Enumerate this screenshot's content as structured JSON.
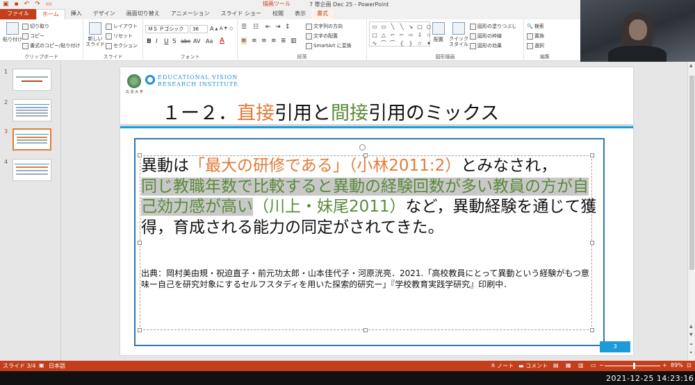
{
  "window": {
    "title": "7  帯企画  Dec 25 - PowerPoint",
    "context_tab_group": "描画ツール"
  },
  "tabs": [
    "ファイル",
    "ホーム",
    "挿入",
    "デザイン",
    "画面切り替え",
    "アニメーション",
    "スライド ショー",
    "校閲",
    "表示",
    "書式"
  ],
  "ribbon": {
    "clipboard": {
      "label": "クリップボード",
      "paste": "貼り付け",
      "cut": "切り取り",
      "copy": "コピー",
      "format_painter": "書式のコピー/貼り付け"
    },
    "slides": {
      "label": "スライド",
      "new_slide": "新しい\nスライド",
      "layout": "レイアウト",
      "reset": "リセット",
      "section": "セクション"
    },
    "font": {
      "label": "フォント",
      "font_name": "ＭＳ Ｐゴシック",
      "font_size": "36"
    },
    "paragraph": {
      "label": "段落",
      "text_direction": "文字列の方向",
      "align_text": "文字の配置",
      "smartart": "SmartArt に変換"
    },
    "drawing": {
      "label": "図形描画",
      "arrange": "配置",
      "quick_styles": "クイック\nスタイル",
      "fill": "図形の塗りつぶし",
      "outline": "図形の枠線",
      "effects": "図形の効果"
    },
    "editing": {
      "label": "編集",
      "find": "検索",
      "replace": "置換",
      "select": "選択"
    }
  },
  "thumbnails": [
    {
      "num": "1",
      "selected": false
    },
    {
      "num": "2",
      "selected": false
    },
    {
      "num": "3",
      "selected": true
    },
    {
      "num": "4",
      "selected": false
    }
  ],
  "slide": {
    "logo_caption": "広 島 大 学",
    "brand_line1": "EDUCATIONAL VISION",
    "brand_line2": "RESEARCH INSTITUTE",
    "title": {
      "prefix": "１ー２．",
      "w1": "直接",
      "mid": "引用と",
      "w2": "間接",
      "suffix": "引用のミックス"
    },
    "body": {
      "p1": "異動は",
      "p2": "「最大の研修である」",
      "p3": "（小林2011:2）",
      "p4": "とみなされ，",
      "p5": "同じ教職年数で比較すると異動の経験回数が多い教員の方が自己効力感が高い",
      "p6": "（川上・妹尾2011）",
      "p7": "など，異動経験を通じて獲得，育成される能力の同定がされてきた。"
    },
    "citation": "出典：岡村美由規・祝迫直子・前元功太郎・山本佳代子・河原洸亮．2021.「高校教員にとって異動という経験がもつ意味ー自己を研究対象にするセルフスタディを用いた探索的研究ー」『学校教育実践学研究』印刷中．",
    "page_number": "3"
  },
  "status": {
    "slide_pos": "スライド 3/4",
    "language": "日本語",
    "notes": "ノート",
    "comments": "コメント",
    "zoom": "89%"
  },
  "taskbar": {
    "clock": "2021-12-25  14:23:16"
  },
  "colors": {
    "accent": "#c43e1c",
    "orange_text": "#e07b39",
    "green_text": "#5a8a3a",
    "slide_blue": "#1c9bd8"
  }
}
